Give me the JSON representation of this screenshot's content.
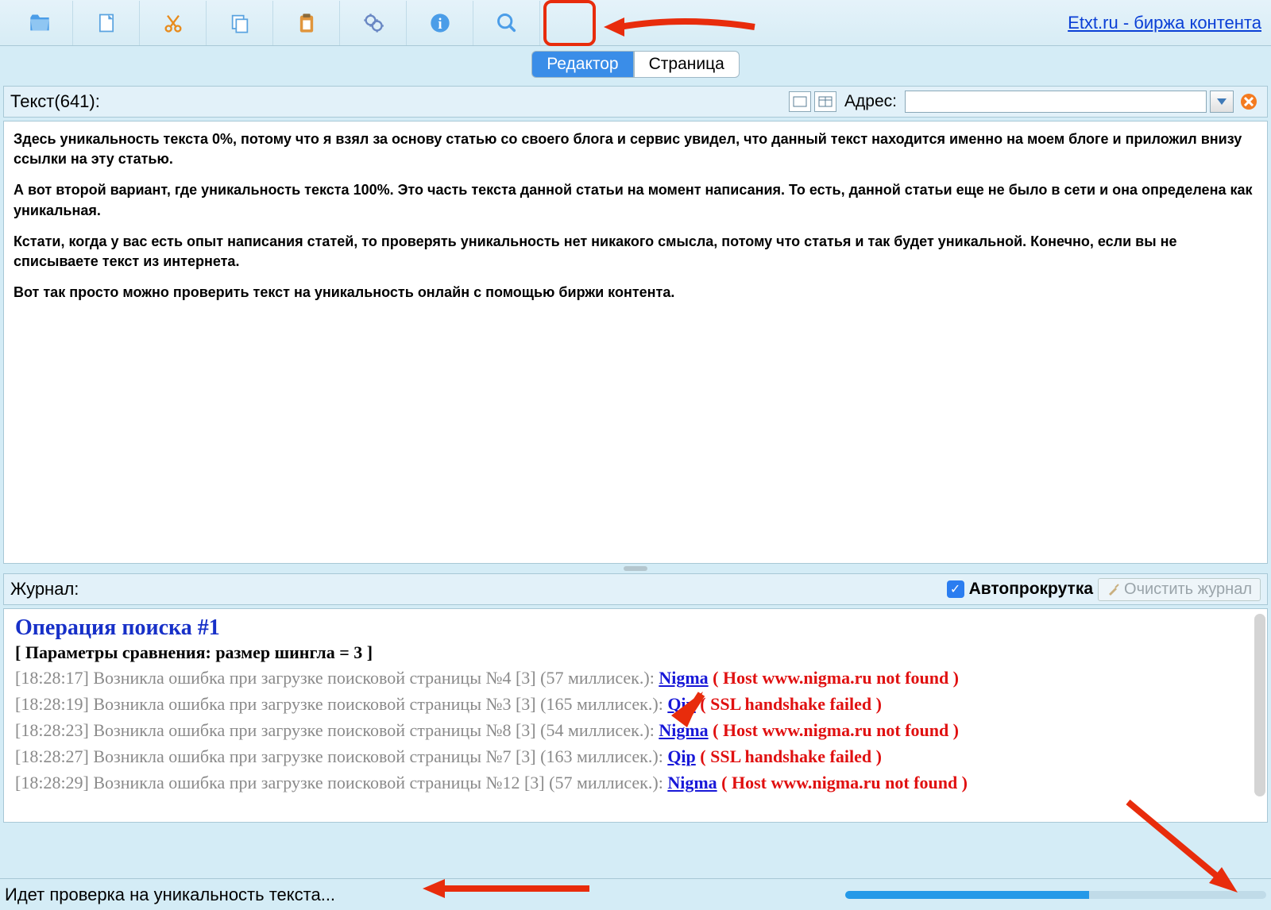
{
  "header_link": "Etxt.ru - биржа контента",
  "tabs": {
    "editor": "Редактор",
    "page": "Страница"
  },
  "text_label": "Текст(641):",
  "addr_label": "Адрес:",
  "editor_paragraphs": [
    "Здесь уникальность текста 0%, потому что я взял за основу статью со своего блога и сервис увидел, что данный текст находится именно на моем блоге и приложил внизу ссылки на эту статью.",
    "А вот второй вариант, где уникальность текста 100%. Это часть текста данной статьи на момент написания. То есть, данной статьи еще не было в сети и она определена как уникальная.",
    "Кстати, когда у вас есть опыт написания статей, то проверять уникальность нет никакого смысла, потому что статья и так будет уникальной. Конечно, если вы не списываете текст из интернета.",
    "Вот так просто можно проверить текст на уникальность онлайн с помощью биржи контента."
  ],
  "log": {
    "header": "Журнал:",
    "autoscroll": "Автопрокрутка",
    "clear": "Очистить журнал",
    "title": "Операция поиска #1",
    "params": "[ Параметры сравнения: размер шингла = 3 ]",
    "lines": [
      {
        "pre": "[18:28:17] Возникла ошибка при загрузке поисковой страницы №4 [3] (57 миллисек.): ",
        "link": "Nigma",
        "err": " ( Host www.nigma.ru not found )"
      },
      {
        "pre": "[18:28:19] Возникла ошибка при загрузке поисковой страницы №3 [3] (165 миллисек.): ",
        "link": "Qip",
        "err": " ( SSL handshake failed )"
      },
      {
        "pre": "[18:28:23] Возникла ошибка при загрузке поисковой страницы №8 [3] (54 миллисек.): ",
        "link": "Nigma",
        "err": " ( Host www.nigma.ru not found )"
      },
      {
        "pre": "[18:28:27] Возникла ошибка при загрузке поисковой страницы №7 [3] (163 миллисек.): ",
        "link": "Qip",
        "err": " ( SSL handshake failed )"
      },
      {
        "pre": "[18:28:29] Возникла ошибка при загрузке поисковой страницы №12 [3] (57 миллисек.): ",
        "link": "Nigma",
        "err": " ( Host www.nigma.ru not found )"
      }
    ]
  },
  "status": "Идет проверка на уникальность текста...",
  "progress_pct": 58
}
